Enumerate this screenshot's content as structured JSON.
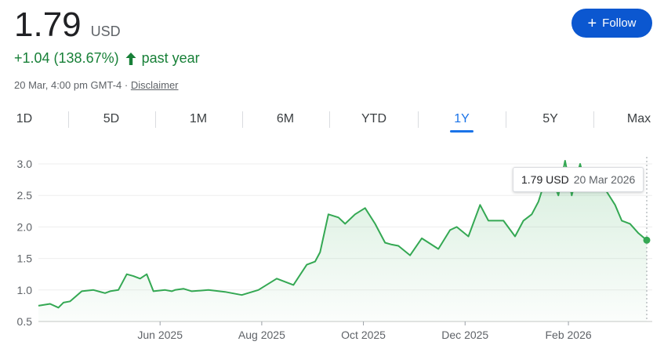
{
  "quote": {
    "price": "1.79",
    "currency": "USD",
    "change": "+1.04 (138.67%)",
    "period": "past year",
    "timestamp": "20 Mar, 4:00 pm GMT-4 · ",
    "disclaimer": "Disclaimer",
    "follow_label": "Follow"
  },
  "colors": {
    "up": "#188038",
    "line": "#34a853",
    "accent": "#1a73e8",
    "follow_bg": "#0b57d0"
  },
  "tabs": [
    {
      "label": "1D"
    },
    {
      "label": "5D"
    },
    {
      "label": "1M"
    },
    {
      "label": "6M"
    },
    {
      "label": "YTD"
    },
    {
      "label": "1Y",
      "active": true
    },
    {
      "label": "5Y"
    },
    {
      "label": "Max"
    }
  ],
  "tooltip": {
    "value": "1.79 USD",
    "date": "20 Mar 2026"
  },
  "chart_data": {
    "type": "area",
    "series": [
      {
        "x": [
          "2025-03-20",
          "2025-03-27",
          "2025-04-01",
          "2025-04-04",
          "2025-04-08",
          "2025-04-15",
          "2025-04-22",
          "2025-04-29",
          "2025-05-02",
          "2025-05-07",
          "2025-05-12",
          "2025-05-16",
          "2025-05-20",
          "2025-05-24",
          "2025-05-28",
          "2025-06-04",
          "2025-06-08",
          "2025-06-10",
          "2025-06-15",
          "2025-06-20",
          "2025-06-30",
          "2025-07-10",
          "2025-07-20",
          "2025-07-30",
          "2025-08-10",
          "2025-08-20",
          "2025-08-28",
          "2025-09-02",
          "2025-09-05",
          "2025-09-10",
          "2025-09-16",
          "2025-09-20",
          "2025-09-26",
          "2025-10-02",
          "2025-10-08",
          "2025-10-10",
          "2025-10-14",
          "2025-10-18",
          "2025-10-22",
          "2025-10-29",
          "2025-11-05",
          "2025-11-15",
          "2025-11-22",
          "2025-11-26",
          "2025-12-03",
          "2025-12-10",
          "2025-12-15",
          "2025-12-24",
          "2025-12-31",
          "2026-01-05",
          "2026-01-10",
          "2026-01-14",
          "2026-01-20",
          "2026-01-26",
          "2026-01-30",
          "2026-02-03",
          "2026-02-08",
          "2026-02-12",
          "2026-02-17",
          "2026-02-23",
          "2026-03-01",
          "2026-03-05",
          "2026-03-10",
          "2026-03-15",
          "2026-03-20"
        ],
        "y": [
          0.75,
          0.78,
          0.72,
          0.8,
          0.82,
          0.98,
          1.0,
          0.95,
          0.98,
          1.0,
          1.25,
          1.22,
          1.18,
          1.25,
          0.98,
          1.0,
          0.98,
          1.0,
          1.02,
          0.98,
          1.0,
          0.97,
          0.92,
          1.0,
          1.18,
          1.08,
          1.4,
          1.45,
          1.6,
          2.2,
          2.15,
          2.05,
          2.2,
          2.3,
          2.05,
          1.95,
          1.75,
          1.72,
          1.7,
          1.55,
          1.82,
          1.65,
          1.95,
          2.0,
          1.85,
          2.35,
          2.1,
          2.1,
          1.85,
          2.1,
          2.2,
          2.4,
          2.9,
          2.5,
          3.05,
          2.5,
          3.0,
          2.6,
          2.8,
          2.6,
          2.35,
          2.1,
          2.05,
          1.9,
          1.79
        ]
      }
    ],
    "ylim": [
      0.5,
      3.0
    ],
    "yticks": [
      "0.5",
      "1.0",
      "1.5",
      "2.0",
      "2.5",
      "3.0"
    ],
    "xticks": [
      "Jun 2025",
      "Aug 2025",
      "Oct 2025",
      "Dec 2025",
      "Feb 2026"
    ],
    "xtick_dates": [
      "2025-06-01",
      "2025-08-01",
      "2025-10-01",
      "2025-12-01",
      "2026-02-01"
    ],
    "grid": true
  }
}
